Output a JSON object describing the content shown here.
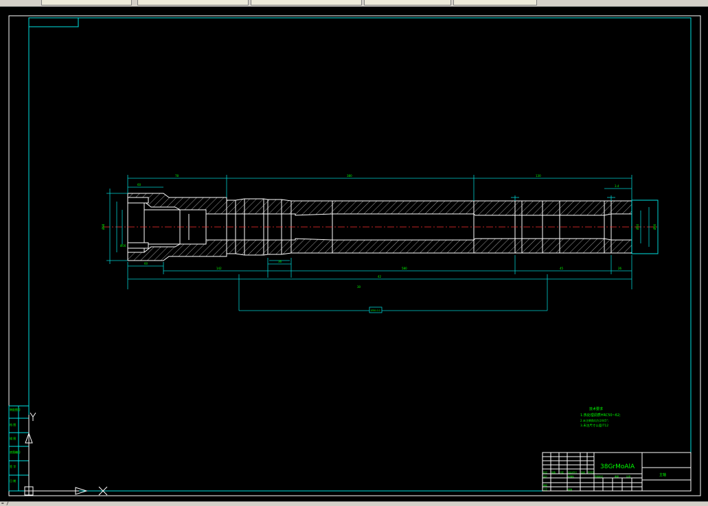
{
  "window": {
    "tabs": [
      "",
      "",
      "",
      "",
      "",
      ""
    ]
  },
  "statusbar": {
    "text": "=  /"
  },
  "drawing": {
    "material": "38GrMoAlA",
    "title_right": "主轴",
    "notes": {
      "heading": "技术要求",
      "lines": [
        "1.热处理调质HRC50~62;",
        "2.未注倒角均为1X45°;",
        "3.未注尺寸公差IT12"
      ]
    },
    "title_block_labels": [
      "标记",
      "处数",
      "分区",
      "更改文件号",
      "签名",
      "年月日",
      "设计",
      "标准化",
      "阶段标记",
      "重量",
      "比例",
      "审核",
      "工艺",
      "批准"
    ],
    "left_strip": [
      "装配图号",
      "档 图",
      "描 图",
      "底图编号",
      "签 字",
      "日 期"
    ],
    "dim_labels": [
      "78",
      "380",
      "130",
      "142",
      "580",
      "45",
      "42",
      "30",
      "60",
      "60",
      "36",
      "26",
      "3.4"
    ],
    "center_box": "Ø50-0.1"
  },
  "ucs": {
    "x_label": "X",
    "y_label": "Y"
  },
  "colors": {
    "background": "#000000",
    "frame": "#00e5e5",
    "hatch": "#e8e8e8",
    "centerline": "#ff3030",
    "text": "#00ff00",
    "material_text": "#00ff00"
  }
}
